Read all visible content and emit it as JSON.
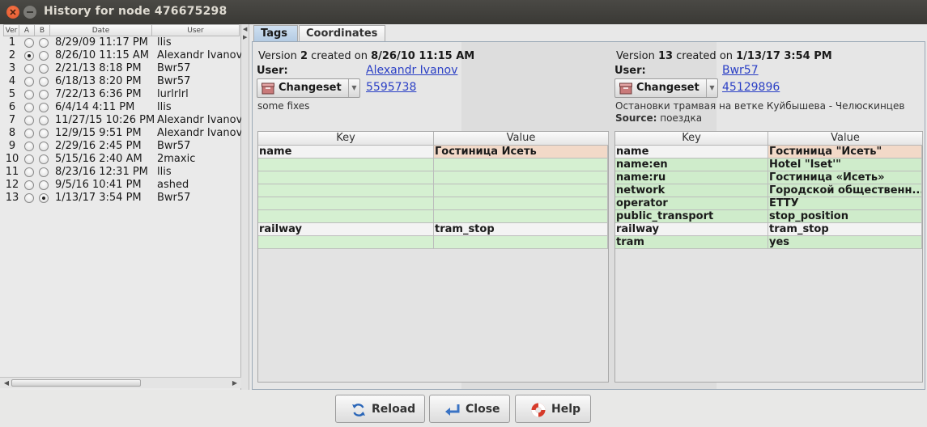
{
  "window": {
    "title": "History for node 476675298"
  },
  "history": {
    "columns": [
      "Ver",
      "A",
      "B",
      "Date",
      "User"
    ],
    "rows": [
      {
        "ver": "1",
        "date": "8/29/09 11:17 PM",
        "user": "llis",
        "a": false,
        "b": false
      },
      {
        "ver": "2",
        "date": "8/26/10 11:15 AM",
        "user": "Alexandr Ivanov",
        "a": true,
        "b": false
      },
      {
        "ver": "3",
        "date": "2/21/13 8:18 PM",
        "user": "Bwr57",
        "a": false,
        "b": false
      },
      {
        "ver": "4",
        "date": "6/18/13 8:20 PM",
        "user": "Bwr57",
        "a": false,
        "b": false
      },
      {
        "ver": "5",
        "date": "7/22/13 6:36 PM",
        "user": "lurlrlrl",
        "a": false,
        "b": false
      },
      {
        "ver": "6",
        "date": "6/4/14 4:11 PM",
        "user": "llis",
        "a": false,
        "b": false
      },
      {
        "ver": "7",
        "date": "11/27/15 10:26 PM",
        "user": "Alexandr Ivanov",
        "a": false,
        "b": false
      },
      {
        "ver": "8",
        "date": "12/9/15 9:51 PM",
        "user": "Alexandr Ivanov",
        "a": false,
        "b": false
      },
      {
        "ver": "9",
        "date": "2/29/16 2:45 PM",
        "user": "Bwr57",
        "a": false,
        "b": false
      },
      {
        "ver": "10",
        "date": "5/15/16 2:40 AM",
        "user": "2maxic",
        "a": false,
        "b": false
      },
      {
        "ver": "11",
        "date": "8/23/16 12:31 PM",
        "user": "llis",
        "a": false,
        "b": false
      },
      {
        "ver": "12",
        "date": "9/5/16 10:41 PM",
        "user": "ashed",
        "a": false,
        "b": false
      },
      {
        "ver": "13",
        "date": "1/13/17 3:54 PM",
        "user": "Bwr57",
        "a": false,
        "b": true
      }
    ]
  },
  "tabs": [
    {
      "label": "Tags",
      "active": true
    },
    {
      "label": "Coordinates",
      "active": false
    }
  ],
  "left_version": {
    "prefix": "Version ",
    "number": "2",
    "middle": " created on ",
    "date": "8/26/10 11:15 AM",
    "user_label": "User:",
    "user": "Alexandr Ivanov",
    "changeset_button": "Changeset",
    "changeset_id": "5595738",
    "comment": "some fixes",
    "source_label": "",
    "source_value": ""
  },
  "right_version": {
    "prefix": "Version ",
    "number": "13",
    "middle": " created on ",
    "date": "1/13/17 3:54 PM",
    "user_label": "User:",
    "user": "Bwr57",
    "changeset_button": "Changeset",
    "changeset_id": "45129896",
    "comment": "Остановки трамвая на ветке Куйбышева - Челюскинцев",
    "source_label": "Source:",
    "source_value": "поездка"
  },
  "tag_table_headers": {
    "key": "Key",
    "value": "Value"
  },
  "left_tags": [
    {
      "key": "name",
      "value": "Гостиница Исеть",
      "state": "changed"
    },
    {
      "key": "",
      "value": "",
      "state": "empty"
    },
    {
      "key": "",
      "value": "",
      "state": "empty"
    },
    {
      "key": "",
      "value": "",
      "state": "empty"
    },
    {
      "key": "",
      "value": "",
      "state": "empty"
    },
    {
      "key": "",
      "value": "",
      "state": "empty"
    },
    {
      "key": "railway",
      "value": "tram_stop",
      "state": "same"
    },
    {
      "key": "",
      "value": "",
      "state": "empty"
    }
  ],
  "right_tags": [
    {
      "key": "name",
      "value": "Гостиница \"Исеть\"",
      "state": "changed"
    },
    {
      "key": "name:en",
      "value": "Hotel \"Iset'\"",
      "state": "green"
    },
    {
      "key": "name:ru",
      "value": "Гостиница «Исеть»",
      "state": "green"
    },
    {
      "key": "network",
      "value": "Городской общественн...",
      "state": "green"
    },
    {
      "key": "operator",
      "value": "ЕТТУ",
      "state": "green"
    },
    {
      "key": "public_transport",
      "value": "stop_position",
      "state": "green"
    },
    {
      "key": "railway",
      "value": "tram_stop",
      "state": "same"
    },
    {
      "key": "tram",
      "value": "yes",
      "state": "green"
    }
  ],
  "buttons": {
    "reload": "Reload",
    "close": "Close",
    "help": "Help"
  },
  "icons": {
    "window_close": "close-icon",
    "window_minimize": "minimize-icon",
    "changeset": "changeset-box-icon",
    "reload": "reload-icon",
    "close": "close-arrow-icon",
    "help": "lifebuoy-icon"
  },
  "colors": {
    "tag_changed": "#f2d9c8",
    "tag_added": "#cfeccb",
    "tag_missing": "#d5f0d1",
    "active_tab": "#b4cbe3",
    "link": "#2a3fc5"
  }
}
